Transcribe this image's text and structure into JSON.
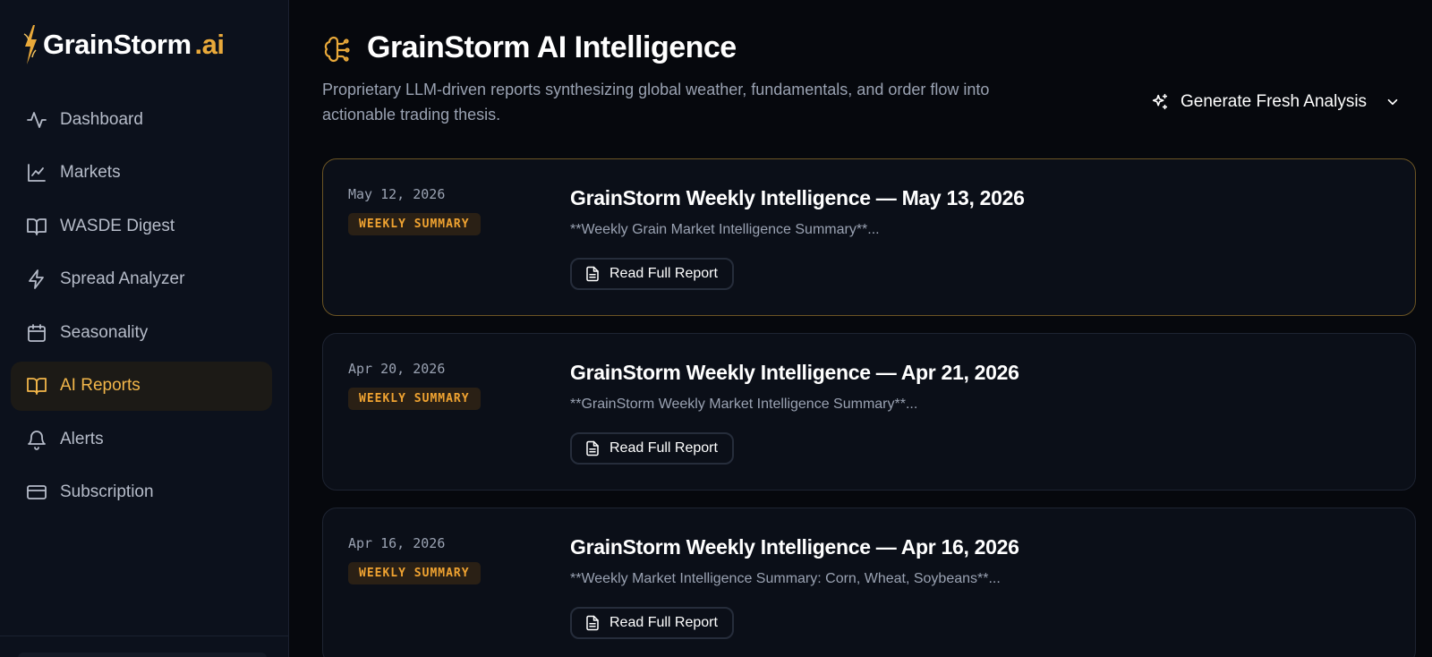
{
  "brand": {
    "name": "GrainStorm",
    "tld": ".ai"
  },
  "sidebar": {
    "items": [
      {
        "label": "Dashboard",
        "icon": "activity-icon",
        "active": false
      },
      {
        "label": "Markets",
        "icon": "line-chart-icon",
        "active": false
      },
      {
        "label": "WASDE Digest",
        "icon": "book-open-icon",
        "active": false
      },
      {
        "label": "Spread Analyzer",
        "icon": "zap-icon",
        "active": false
      },
      {
        "label": "Seasonality",
        "icon": "calendar-icon",
        "active": false
      },
      {
        "label": "AI Reports",
        "icon": "book-open-icon",
        "active": true
      },
      {
        "label": "Alerts",
        "icon": "bell-icon",
        "active": false
      },
      {
        "label": "Subscription",
        "icon": "credit-card-icon",
        "active": false
      }
    ]
  },
  "header": {
    "icon": "brain-icon",
    "title": "GrainStorm AI Intelligence",
    "subtitle": "Proprietary LLM-driven reports synthesizing global weather, fundamentals, and order flow into actionable trading thesis.",
    "generate_label": "Generate Fresh Analysis"
  },
  "reports": [
    {
      "date": "May 12, 2026",
      "badge": "WEEKLY SUMMARY",
      "title": "GrainStorm Weekly Intelligence — May 13, 2026",
      "excerpt": "**Weekly Grain Market Intelligence Summary**...",
      "button": "Read Full Report"
    },
    {
      "date": "Apr 20, 2026",
      "badge": "WEEKLY SUMMARY",
      "title": "GrainStorm Weekly Intelligence — Apr 21, 2026",
      "excerpt": "**GrainStorm Weekly Market Intelligence Summary**...",
      "button": "Read Full Report"
    },
    {
      "date": "Apr 16, 2026",
      "badge": "WEEKLY SUMMARY",
      "title": "GrainStorm Weekly Intelligence — Apr 16, 2026",
      "excerpt": "**Weekly Market Intelligence Summary: Corn, Wheat, Soybeans**...",
      "button": "Read Full Report"
    }
  ],
  "colors": {
    "accent": "#f2b64a",
    "badge_text": "#f0a331",
    "background": "#06080d",
    "sidebar": "#0c111c"
  }
}
